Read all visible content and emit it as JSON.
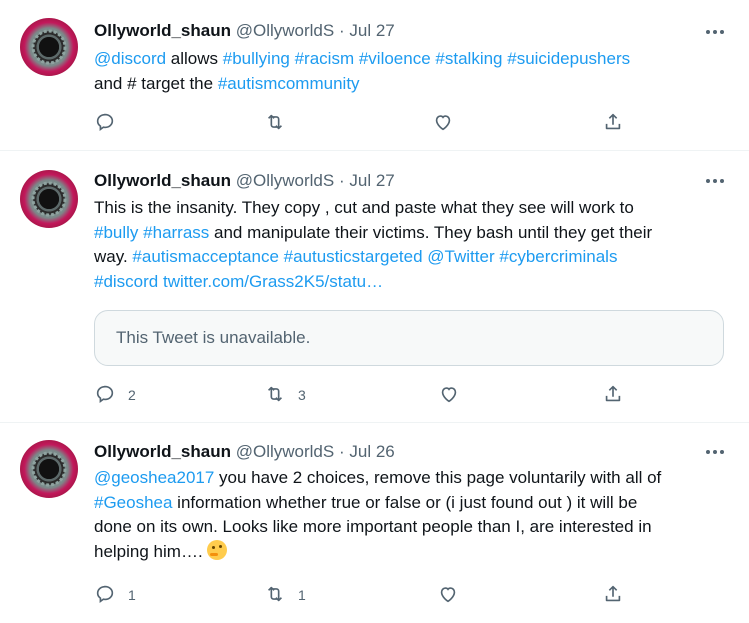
{
  "tweets": [
    {
      "name": "Ollyworld_shaun",
      "handle": "@OllyworldS",
      "dot": "·",
      "date": "Jul 27",
      "lines": [
        [
          {
            "t": "@discord",
            "link": true
          },
          {
            "t": " allows ",
            "link": false
          },
          {
            "t": "#bullying",
            "link": true
          },
          {
            "t": " ",
            "link": false
          },
          {
            "t": "#racism",
            "link": true
          },
          {
            "t": " ",
            "link": false
          },
          {
            "t": "#viloence",
            "link": true
          },
          {
            "t": " ",
            "link": false
          },
          {
            "t": "#stalking",
            "link": true
          },
          {
            "t": " ",
            "link": false
          },
          {
            "t": "#suicidepushers",
            "link": true
          }
        ],
        [
          {
            "t": "and # target the ",
            "link": false
          },
          {
            "t": "#autismcommunity",
            "link": true
          }
        ]
      ],
      "quote": null,
      "reply_count": "",
      "retweet_count": "",
      "like_count": ""
    },
    {
      "name": "Ollyworld_shaun",
      "handle": "@OllyworldS",
      "dot": "·",
      "date": "Jul 27",
      "lines": [
        [
          {
            "t": "This is the insanity. They copy , cut and paste what they see will work to",
            "link": false
          }
        ],
        [
          {
            "t": "#bully",
            "link": true
          },
          {
            "t": " ",
            "link": false
          },
          {
            "t": "#harrass",
            "link": true
          },
          {
            "t": " and manipulate their victims. They bash until they get their",
            "link": false
          }
        ],
        [
          {
            "t": "way. ",
            "link": false
          },
          {
            "t": "#autismacceptance",
            "link": true
          },
          {
            "t": " ",
            "link": false
          },
          {
            "t": "#autusticstargeted",
            "link": true
          },
          {
            "t": " ",
            "link": false
          },
          {
            "t": "@Twitter",
            "link": true
          },
          {
            "t": " ",
            "link": false
          },
          {
            "t": "#cybercriminals",
            "link": true
          }
        ],
        [
          {
            "t": "#discord",
            "link": true
          },
          {
            "t": " ",
            "link": false
          },
          {
            "t": "twitter.com/Grass2K5/statu…",
            "link": true
          }
        ]
      ],
      "quote": "This Tweet is unavailable.",
      "reply_count": "2",
      "retweet_count": "3",
      "like_count": ""
    },
    {
      "name": "Ollyworld_shaun",
      "handle": "@OllyworldS",
      "dot": "·",
      "date": "Jul 26",
      "lines": [
        [
          {
            "t": "@geoshea2017",
            "link": true
          },
          {
            "t": " you have 2 choices, remove this page voluntarily with all of",
            "link": false
          }
        ],
        [
          {
            "t": "#Geoshea",
            "link": true
          },
          {
            "t": " information whether true or false or (i just found out ) it will be",
            "link": false
          }
        ],
        [
          {
            "t": "done on its own. Looks like more important people than I, are interested in",
            "link": false
          }
        ],
        [
          {
            "t": "helping him…. ",
            "link": false
          },
          {
            "t": "",
            "emoji": "thinking-face-emoji",
            "link": false
          }
        ]
      ],
      "quote": null,
      "reply_count": "1",
      "retweet_count": "1",
      "like_count": ""
    }
  ],
  "icons": {
    "reply": "reply-icon",
    "retweet": "retweet-icon",
    "like": "like-icon",
    "share": "share-icon",
    "more": "more-icon"
  },
  "colors": {
    "link": "#1d9bf0",
    "secondary_text": "#536471",
    "divider": "#eff3f4",
    "avatar_pink": "#c2185b"
  }
}
